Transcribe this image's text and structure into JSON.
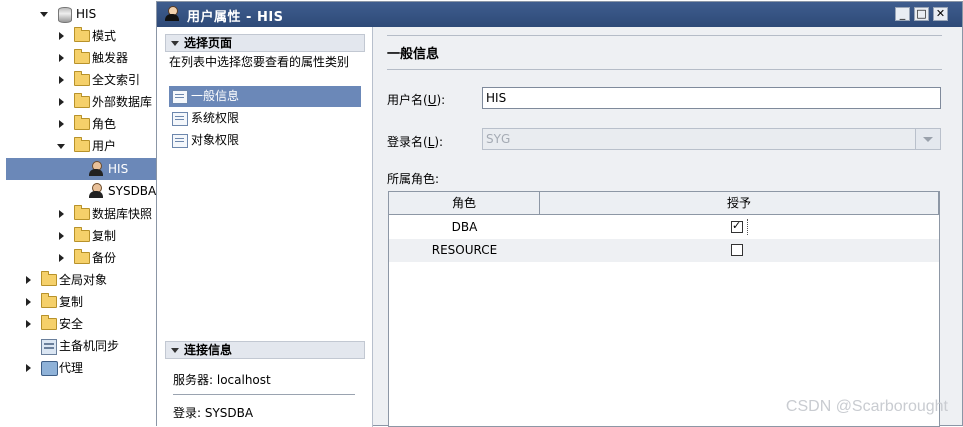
{
  "tree": {
    "items": [
      {
        "label": "HIS",
        "level": "db",
        "expanded": true
      },
      {
        "label": "模式"
      },
      {
        "label": "触发器"
      },
      {
        "label": "全文索引"
      },
      {
        "label": "外部数据库"
      },
      {
        "label": "角色"
      },
      {
        "label": "用户",
        "expanded": true
      },
      {
        "label": "HIS",
        "selected": true
      },
      {
        "label": "SYSDBA"
      },
      {
        "label": "数据库快照"
      },
      {
        "label": "复制"
      },
      {
        "label": "备份"
      },
      {
        "label": "全局对象"
      },
      {
        "label": "复制"
      },
      {
        "label": "安全"
      },
      {
        "label": "主备机同步"
      },
      {
        "label": "代理"
      }
    ]
  },
  "dialog": {
    "title": "用户属性 - HIS",
    "select_page_header": "选择页面",
    "hint": "在列表中选择您要查看的属性类别",
    "pages": [
      {
        "label": "一般信息",
        "selected": true
      },
      {
        "label": "系统权限"
      },
      {
        "label": "对象权限"
      }
    ],
    "connection_header": "连接信息",
    "server_line": "服务器: localhost",
    "login_line": "登录: SYSDBA",
    "general_title": "一般信息",
    "username_label_pre": "用户名(",
    "username_label_key": "U",
    "username_label_post": "):",
    "username_value": "HIS",
    "login_label_pre": "登录名(",
    "login_label_key": "L",
    "login_label_post": "):",
    "login_value": "SYG",
    "roles_label": "所属角色:",
    "roles_columns": [
      "角色",
      "授予"
    ],
    "roles_rows": [
      {
        "role": "DBA",
        "granted": true
      },
      {
        "role": "RESOURCE",
        "granted": false
      }
    ]
  },
  "watermark": "CSDN @Scarborought"
}
